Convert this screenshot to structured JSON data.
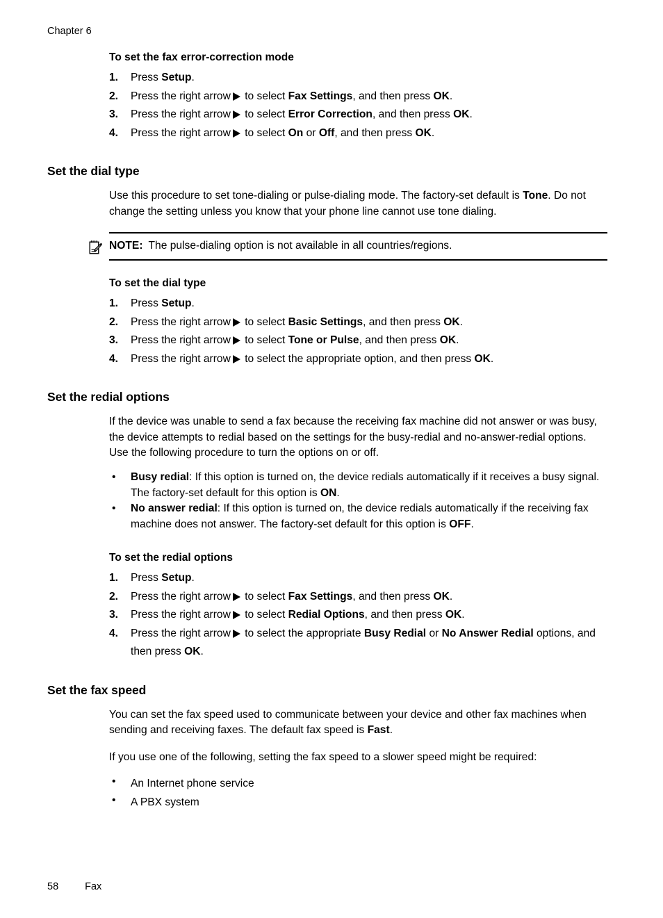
{
  "running_header": "Chapter 6",
  "footer": {
    "page_number": "58",
    "chapter_label": "Fax"
  },
  "icons": {
    "right_arrow": "right-arrow-icon",
    "note": "note-pad-pencil-icon"
  },
  "proc_error_correction": {
    "heading": "To set the fax error-correction mode",
    "steps": [
      {
        "num": "1.",
        "pre": "Press ",
        "bold1": "Setup",
        "mid": ".",
        "has_arrow": false
      },
      {
        "num": "2.",
        "pre": "Press the right arrow",
        "post1": " to select ",
        "bold1": "Fax Settings",
        "post2": ", and then press ",
        "bold2": "OK",
        "post3": ".",
        "has_arrow": true
      },
      {
        "num": "3.",
        "pre": "Press the right arrow",
        "post1": " to select ",
        "bold1": "Error Correction",
        "post2": ", and then press ",
        "bold2": "OK",
        "post3": ".",
        "has_arrow": true
      },
      {
        "num": "4.",
        "pre": "Press the right arrow",
        "post1": " to select ",
        "bold1": "On",
        "post2": " or ",
        "bold2": "Off",
        "post3": ", and then press ",
        "bold3": "OK",
        "post4": ".",
        "has_arrow": true
      }
    ]
  },
  "section_dial_type": {
    "heading": "Set the dial type",
    "para_a": "Use this procedure to set tone-dialing or pulse-dialing mode. The factory-set default is ",
    "para_a_bold": "Tone",
    "para_a_end": ". Do not change the setting unless you know that your phone line cannot use tone dialing.",
    "note": {
      "label": "NOTE:",
      "text": "The pulse-dialing option is not available in all countries/regions."
    },
    "proc": {
      "heading": "To set the dial type",
      "steps": [
        {
          "num": "1.",
          "pre": "Press ",
          "bold1": "Setup",
          "mid": ".",
          "has_arrow": false
        },
        {
          "num": "2.",
          "pre": "Press the right arrow",
          "post1": " to select ",
          "bold1": "Basic Settings",
          "post2": ", and then press ",
          "bold2": "OK",
          "post3": ".",
          "has_arrow": true
        },
        {
          "num": "3.",
          "pre": "Press the right arrow",
          "post1": " to select ",
          "bold1": "Tone or Pulse",
          "post2": ", and then press ",
          "bold2": "OK",
          "post3": ".",
          "has_arrow": true
        },
        {
          "num": "4.",
          "pre": "Press the right arrow",
          "post1": " to select the appropriate option, and then press ",
          "bold1": "OK",
          "post2": ".",
          "has_arrow": true
        }
      ]
    }
  },
  "section_redial": {
    "heading": "Set the redial options",
    "para_a": "If the device was unable to send a fax because the receiving fax machine did not answer or was busy, the device attempts to redial based on the settings for the busy-redial and no-answer-redial options. Use the following procedure to turn the options on or off.",
    "bullets": [
      {
        "bold1": "Busy redial",
        "text1": ": If this option is turned on, the device redials automatically if it receives a busy signal. The factory-set default for this option is ",
        "bold2": "ON",
        "text2": "."
      },
      {
        "bold1": "No answer redial",
        "text1": ": If this option is turned on, the device redials automatically if the receiving fax machine does not answer. The factory-set default for this option is ",
        "bold2": "OFF",
        "text2": "."
      }
    ],
    "proc": {
      "heading": "To set the redial options",
      "steps": [
        {
          "num": "1.",
          "pre": "Press ",
          "bold1": "Setup",
          "mid": ".",
          "has_arrow": false
        },
        {
          "num": "2.",
          "pre": "Press the right arrow",
          "post1": " to select ",
          "bold1": "Fax Settings",
          "post2": ", and then press ",
          "bold2": "OK",
          "post3": ".",
          "has_arrow": true
        },
        {
          "num": "3.",
          "pre": "Press the right arrow",
          "post1": " to select ",
          "bold1": "Redial Options",
          "post2": ", and then press ",
          "bold2": "OK",
          "post3": ".",
          "has_arrow": true
        },
        {
          "num": "4.",
          "pre": "Press the right arrow",
          "post1": " to select the appropriate ",
          "bold1": "Busy Redial",
          "post2": " or ",
          "bold2": "No Answer Redial",
          "post3": " options, and then press ",
          "bold3": "OK",
          "post4": ".",
          "has_arrow": true
        }
      ]
    }
  },
  "section_fax_speed": {
    "heading": "Set the fax speed",
    "para_a": "You can set the fax speed used to communicate between your device and other fax machines when sending and receiving faxes. The default fax speed is ",
    "para_a_bold": "Fast",
    "para_a_end": ".",
    "para_b": "If you use one of the following, setting the fax speed to a slower speed might be required:",
    "bullets": [
      {
        "text1": "An Internet phone service"
      },
      {
        "text1": "A PBX system"
      }
    ]
  }
}
